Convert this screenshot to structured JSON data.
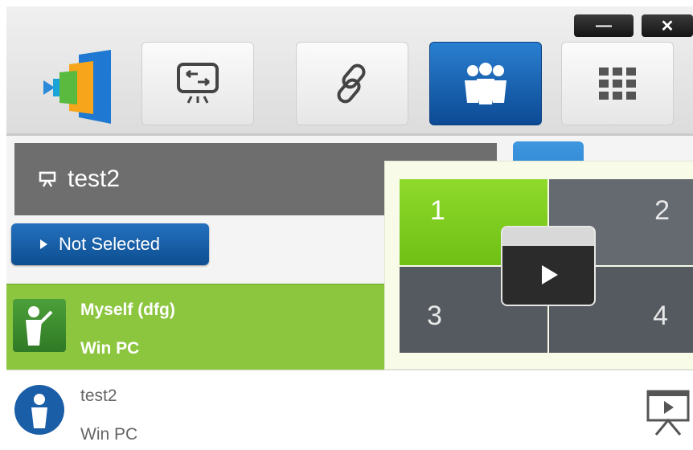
{
  "window": {
    "minimize_label": "—",
    "close_label": "✕"
  },
  "toolbar": {
    "buttons": [
      {
        "name": "screen-switch",
        "icon": "screen-switch-icon"
      },
      {
        "name": "link",
        "icon": "link-icon"
      },
      {
        "name": "group",
        "icon": "group-icon",
        "active": true
      },
      {
        "name": "grid",
        "icon": "grid-icon"
      }
    ],
    "accent": "#1565b8"
  },
  "session": {
    "title": "test2",
    "status_button": "Not Selected"
  },
  "participants": [
    {
      "name": "Myself (dfg)",
      "device": "Win PC",
      "selected": true
    },
    {
      "name": "test2",
      "device": "Win PC",
      "selected": false
    }
  ],
  "split_view": {
    "cells": [
      "1",
      "2",
      "3",
      "4"
    ],
    "active_color": "#7ac91b"
  }
}
